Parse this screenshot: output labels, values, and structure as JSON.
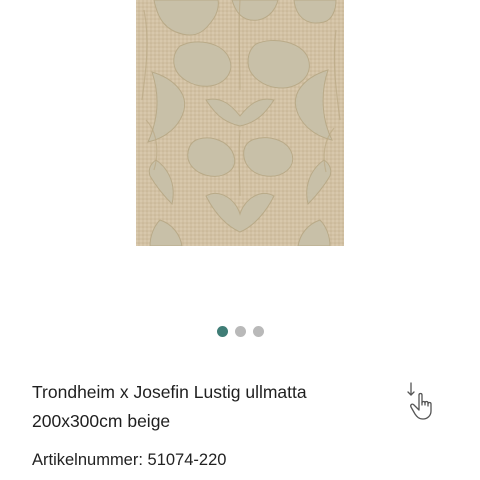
{
  "gallery": {
    "image": "rug-image",
    "dots": [
      {
        "state": "active",
        "color": "#3f7d76"
      },
      {
        "state": "inactive",
        "color": "#b9b9b9"
      },
      {
        "state": "inactive",
        "color": "#b9b9b9"
      }
    ]
  },
  "product": {
    "title_line1": "Trondheim x Josefin Lustig ullmatta",
    "title_line2": "200x300cm beige",
    "article_number": "Artikelnummer: 51074-220"
  },
  "icons": {
    "swipe": "swipe-down-hand-icon"
  },
  "colors": {
    "rug_base": "#d3c3a8",
    "rug_ridge": "#c9b692",
    "rug_channel": "#c7bfa8",
    "accent": "#3f7d76"
  }
}
